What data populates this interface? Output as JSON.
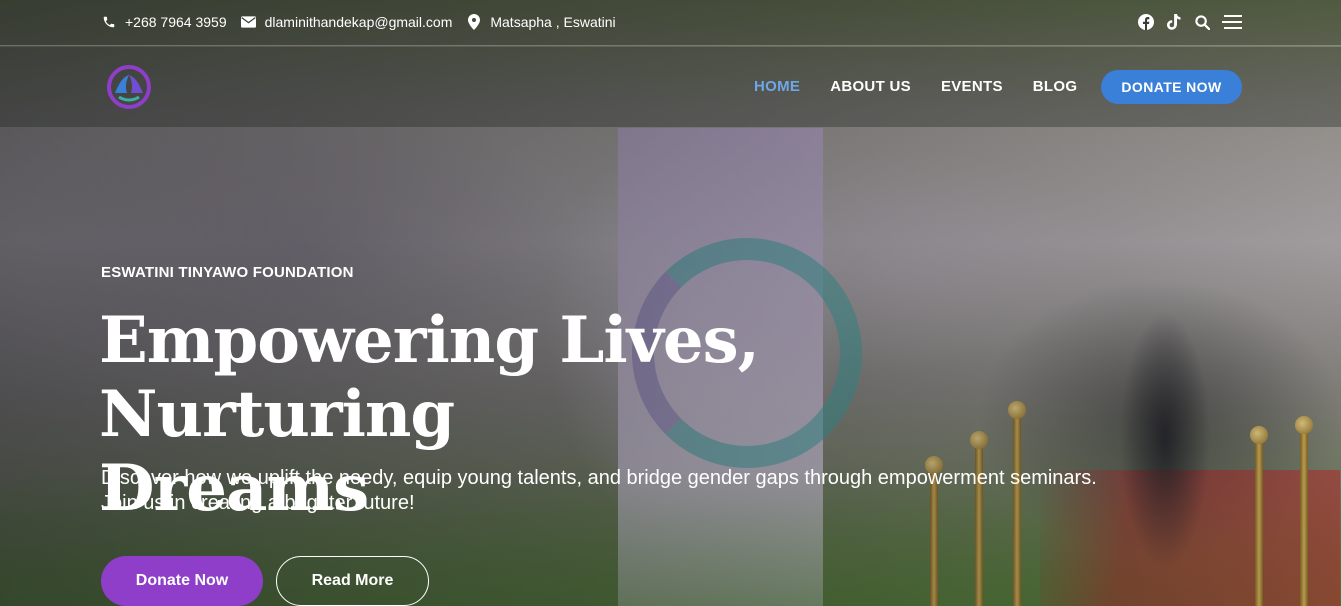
{
  "topbar": {
    "phone": "+268 7964 3959",
    "email": "dlaminithandekap@gmail.com",
    "location": "Matsapha , Eswatini",
    "icons": [
      "phone-icon",
      "mail-icon",
      "location-pin-icon",
      "facebook-icon",
      "tiktok-icon",
      "search-icon",
      "menu-icon"
    ]
  },
  "nav": {
    "items": [
      {
        "label": "HOME",
        "active": true
      },
      {
        "label": "ABOUT US",
        "active": false
      },
      {
        "label": "EVENTS",
        "active": false
      },
      {
        "label": "BLOG",
        "active": false
      }
    ],
    "donate_label": "DONATE NOW"
  },
  "hero": {
    "eyebrow": "ESWATINI TINYAWO FOUNDATION",
    "headline_line1": "Empowering Lives, Nurturing",
    "headline_line2": "Dreams",
    "lead": "Discover how we uplift the needy, equip young talents, and bridge gender gaps through empowerment seminars. Join us in creating a brighter future!",
    "donate_label": "Donate Now",
    "read_more_label": "Read More"
  },
  "colors": {
    "accent_blue": "#3a7fd8",
    "active_nav": "#6fa6e8",
    "primary_purple": "#8e3ec9"
  }
}
